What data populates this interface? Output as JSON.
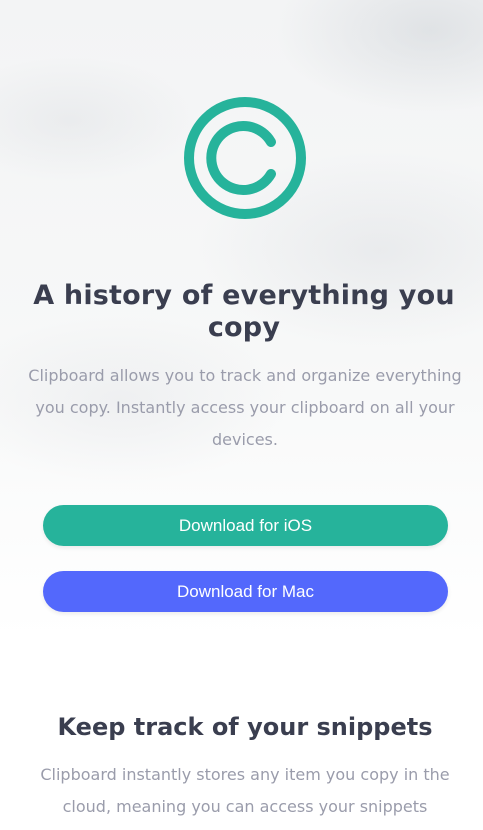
{
  "colors": {
    "accent_green": "#26b39b",
    "accent_blue": "#5368fc",
    "heading": "#3a3e4f",
    "body_text": "#9a9cab"
  },
  "hero": {
    "logo_icon": "copyright-circle-icon",
    "title": "A history of everything you copy",
    "description": "Clipboard allows you to track and organize everything you copy. Instantly access your clipboard on all your devices."
  },
  "buttons": {
    "ios_label": "Download for iOS",
    "mac_label": "Download for Mac"
  },
  "snippets": {
    "title": "Keep track of your snippets",
    "description": "Clipboard instantly stores any item you copy in the cloud, meaning you can access your snippets"
  }
}
